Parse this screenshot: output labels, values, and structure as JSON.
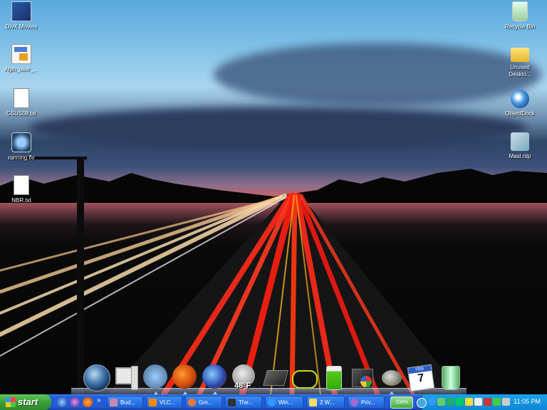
{
  "desktop": {
    "icons_left": [
      {
        "name": "divx-movies",
        "label": "DivX Movies"
      },
      {
        "name": "alpha-user-pdf",
        "label": "Alph_user_..."
      },
      {
        "name": "csu-txt",
        "label": "CSUS08.txt"
      },
      {
        "name": "running-flv",
        "label": "running.flv"
      },
      {
        "name": "nbr-txt",
        "label": "NBR.txt"
      }
    ],
    "icons_right": [
      {
        "name": "recycle-bin",
        "label": "Recycle Bin"
      },
      {
        "name": "unused-desktop",
        "label": "Unused Deskto..."
      },
      {
        "name": "objectdock",
        "label": "ObjectDock"
      },
      {
        "name": "masl-rdp",
        "label": "Masl.rdp"
      }
    ]
  },
  "dock": {
    "weather_temp": "48°F",
    "calendar_month": "FEB",
    "calendar_day": "7"
  },
  "taskbar": {
    "start_label": "start",
    "quicklaunch_more": "»",
    "tasks": [
      "Bud...",
      "VLC...",
      "Gm...",
      "The...",
      "Win...",
      "2 W...",
      "Priv..."
    ],
    "tray_badge": "100%",
    "clock": "11:05 PM"
  },
  "colors": {
    "taskbar_blue": "#245edb",
    "start_green": "#3c9f38",
    "tray_blue": "#0e87d6"
  }
}
